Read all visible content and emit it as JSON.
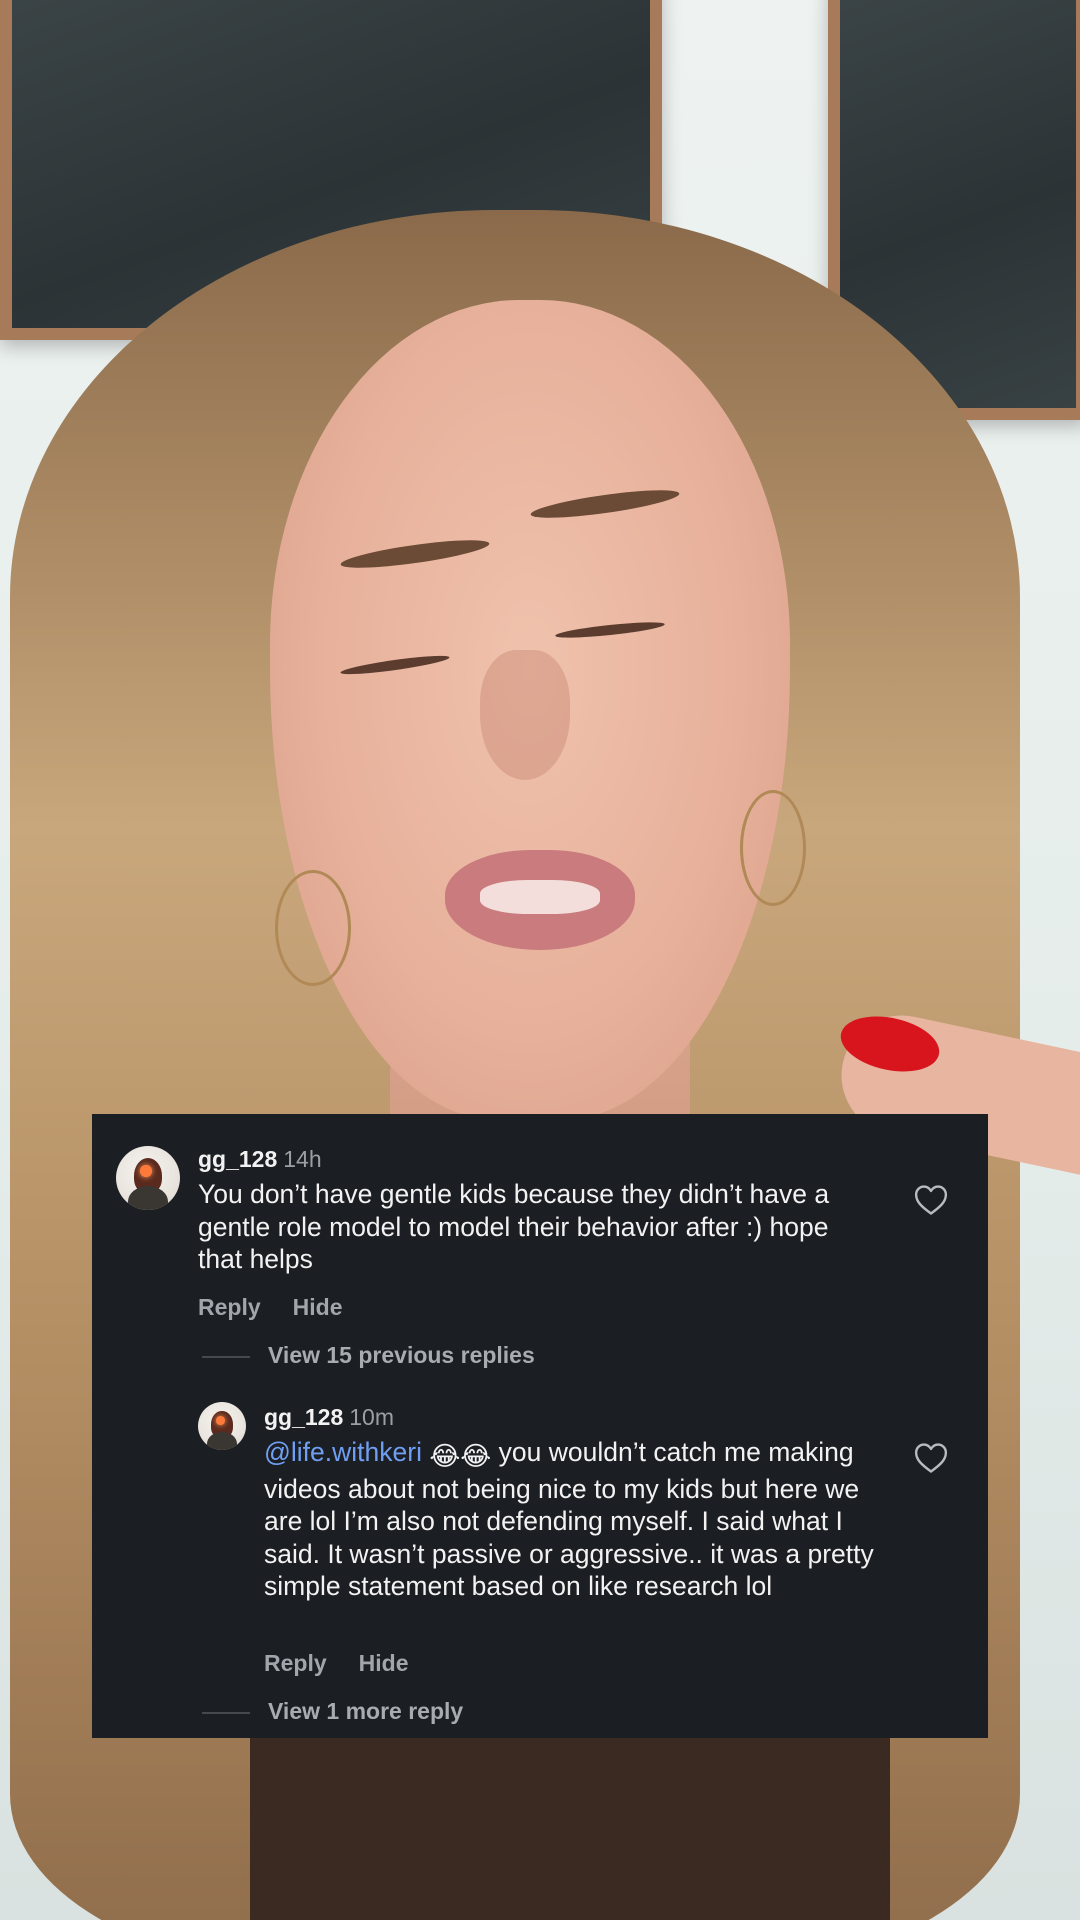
{
  "comments": [
    {
      "username": "gg_128",
      "time": "14h",
      "text": "You don’t have gentle kids because they didn’t have a gentle role model to model their behavior after :) hope that helps",
      "reply_label": "Reply",
      "hide_label": "Hide",
      "like_icon": "heart-outline-icon"
    },
    {
      "username": "gg_128",
      "time": "10m",
      "mention": "@life.withkeri",
      "emojis": "😂😂",
      "text": " you wouldn’t catch me making videos about not being nice to my kids but here we are lol I’m also not defending myself. I said what I said. It wasn’t passive or aggressive.. it was a pretty simple statement based on like research lol",
      "reply_label": "Reply",
      "hide_label": "Hide",
      "like_icon": "heart-outline-icon"
    }
  ],
  "view_previous_replies": "View 15 previous replies",
  "view_more_replies": "View 1 more reply",
  "colors": {
    "panel_bg": "#1b1e22",
    "mention": "#6f9ff2",
    "muted_text": "#a0a6ab",
    "nail_polish": "#d8141d"
  }
}
